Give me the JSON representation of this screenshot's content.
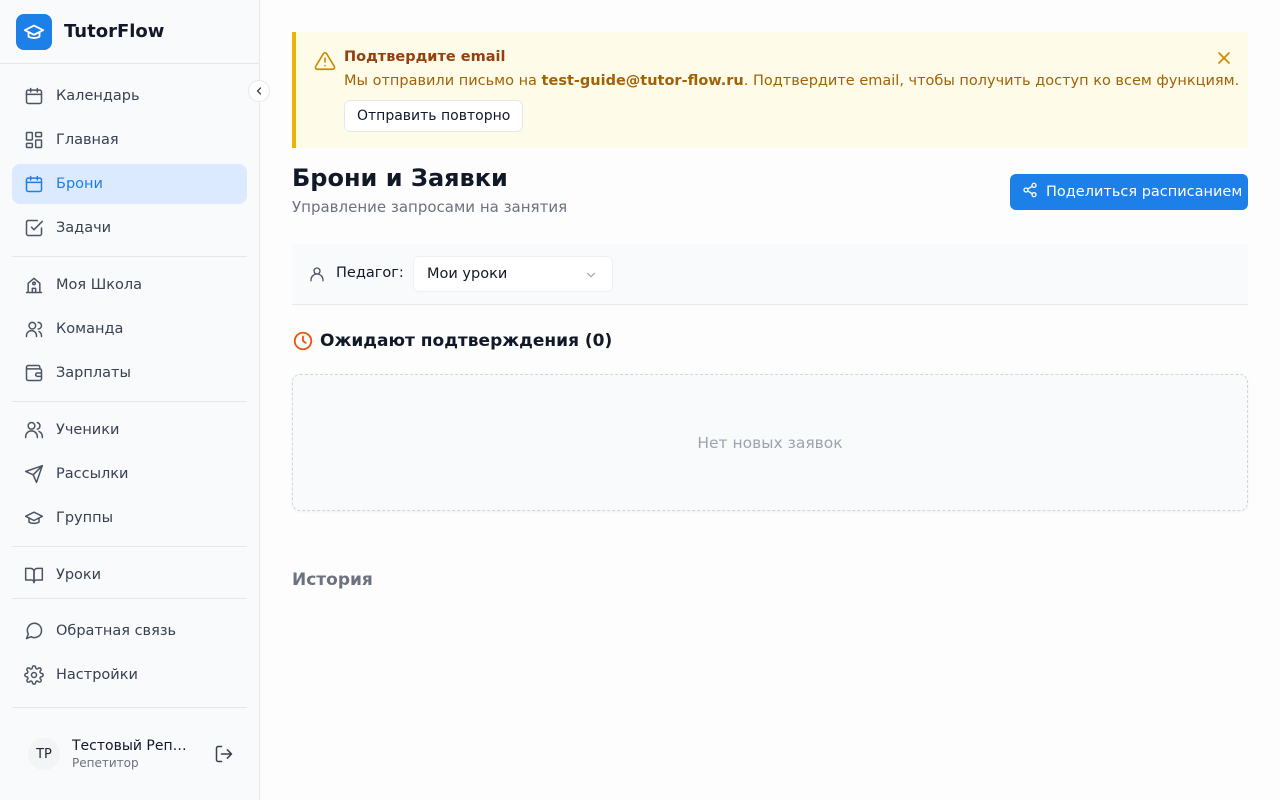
{
  "app": {
    "name": "TutorFlow"
  },
  "sidebar": {
    "items": [
      {
        "label": "Календарь",
        "icon": "calendar-icon"
      },
      {
        "label": "Главная",
        "icon": "dashboard-icon"
      },
      {
        "label": "Брони",
        "icon": "calendar-icon",
        "active": true
      },
      {
        "label": "Задачи",
        "icon": "checkbox-icon"
      },
      {
        "label": "Моя Школа",
        "icon": "school-icon"
      },
      {
        "label": "Команда",
        "icon": "team-icon"
      },
      {
        "label": "Зарплаты",
        "icon": "wallet-icon"
      },
      {
        "label": "Ученики",
        "icon": "users-icon"
      },
      {
        "label": "Рассылки",
        "icon": "send-icon"
      },
      {
        "label": "Группы",
        "icon": "graduation-cap-icon"
      },
      {
        "label": "Уроки",
        "icon": "book-icon"
      },
      {
        "label": "Обратная связь",
        "icon": "message-icon"
      },
      {
        "label": "Настройки",
        "icon": "gear-icon"
      }
    ],
    "user": {
      "initials": "ТР",
      "name": "Тестовый Репетитор",
      "role": "Репетитор"
    }
  },
  "alert": {
    "title": "Подтвердите email",
    "text_before": "Мы отправили письмо на ",
    "email": "test-guide@tutor-flow.ru",
    "text_after": ". Подтвердите email, чтобы получить доступ ко всем функциям.",
    "resend_label": "Отправить повторно"
  },
  "page": {
    "title": "Брони и Заявки",
    "subtitle": "Управление запросами на занятия",
    "share_label": "Поделиться расписанием"
  },
  "filter": {
    "label": "Педагог:",
    "value": "Мои уроки"
  },
  "pending": {
    "title": "Ожидают подтверждения (0)",
    "empty_text": "Нет новых заявок"
  },
  "history": {
    "title": "История"
  },
  "colors": {
    "accent": "#1d7fe8",
    "warning": "#eab308",
    "pending_icon": "#ea580c"
  }
}
